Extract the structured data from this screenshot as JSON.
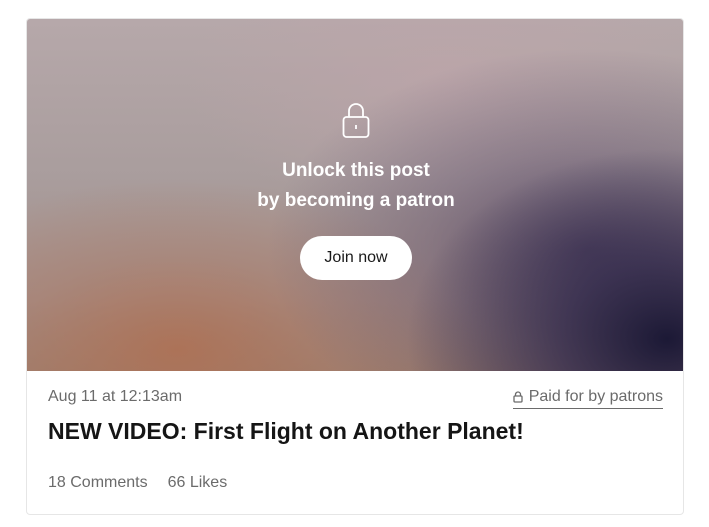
{
  "post": {
    "unlock_line1": "Unlock this post",
    "unlock_line2": "by becoming a patron",
    "join_label": "Join now",
    "date": "Aug 11 at 12:13am",
    "paid_label": "Paid for by patrons",
    "title": "NEW VIDEO: First Flight on Another Planet!",
    "comments": "18 Comments",
    "likes": "66 Likes"
  },
  "icons": {
    "hero_lock": "lock-icon",
    "paid_lock": "lock-icon"
  },
  "colors": {
    "text_muted": "#6b6b6b",
    "title": "#151515",
    "button_bg": "#ffffff"
  }
}
